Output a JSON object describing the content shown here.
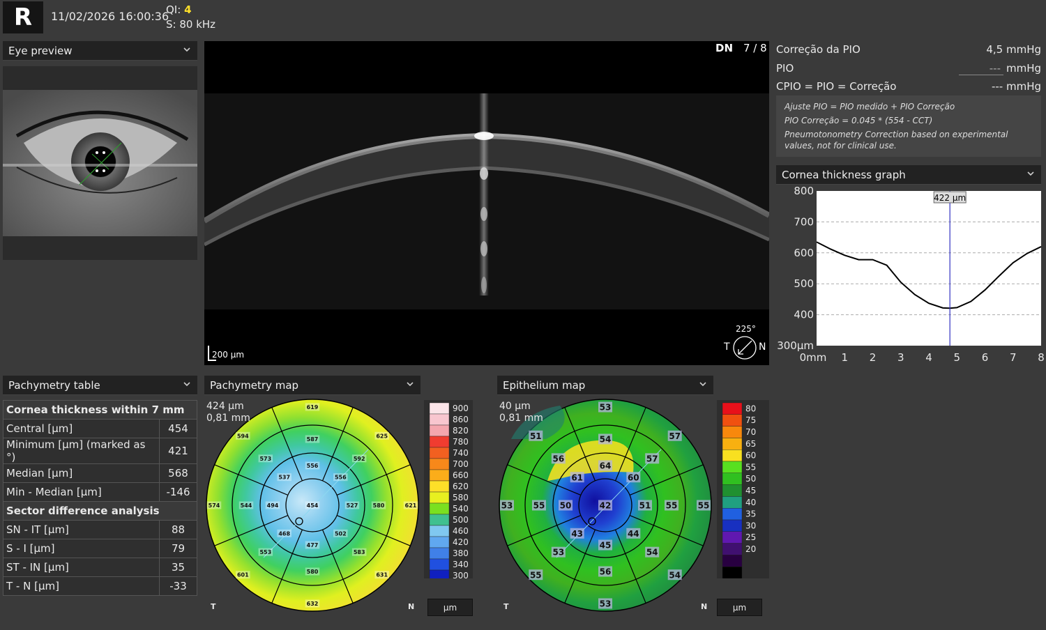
{
  "header": {
    "eye": "R",
    "datetime": "11/02/2026 16:00:36",
    "qi_label": "QI:",
    "qi_value": "4",
    "scan_freq": "S: 80 kHz"
  },
  "eye_preview": {
    "title": "Eye preview"
  },
  "bscan": {
    "view": "DN",
    "index": "7 / 8",
    "scale": "200 µm",
    "angle": "225°",
    "temporal": "T",
    "nasal": "N"
  },
  "pio": {
    "correction_label": "Correção da PIO",
    "correction_value": "4,5 mmHg",
    "pio_label": "PIO",
    "pio_value": "---",
    "pio_unit": "mmHg",
    "cpio_label": "CPIO = PIO = Correção",
    "cpio_value": "--- mmHg",
    "note1": "Ajuste PIO = PIO medido + PIO Correção",
    "note2": "PIO Correção = 0.045 * (554 - CCT)",
    "note3": "Pneumotonometry Correction based on experimental values, not for clinical use."
  },
  "thickness_graph": {
    "title": "Cornea thickness graph",
    "marker_label": "422 µm"
  },
  "chart_data": {
    "type": "line",
    "x": [
      0,
      0.5,
      1,
      1.5,
      2,
      2.5,
      3,
      3.5,
      4,
      4.5,
      4.75,
      5,
      5.5,
      6,
      6.5,
      7,
      7.5,
      8
    ],
    "values": [
      635,
      612,
      592,
      578,
      578,
      560,
      505,
      465,
      437,
      422,
      421,
      423,
      443,
      480,
      525,
      568,
      598,
      620
    ],
    "xlim": [
      0,
      8
    ],
    "ylim": [
      300,
      800
    ],
    "xticks": [
      "0mm",
      "1",
      "2",
      "3",
      "4",
      "5",
      "6",
      "7",
      "8"
    ],
    "yticks": [
      "800",
      "700",
      "600",
      "500",
      "400",
      "300µm"
    ],
    "marker_x": 4.75,
    "grid": true
  },
  "pachy_table": {
    "title": "Pachymetry table",
    "section1": "Cornea thickness within 7 mm",
    "rows1": [
      [
        "Central [µm]",
        "454"
      ],
      [
        "Minimum [µm] (marked as °)",
        "421"
      ],
      [
        "Median [µm]",
        "568"
      ],
      [
        "Min - Median [µm]",
        "-146"
      ]
    ],
    "section2": "Sector difference analysis",
    "rows2": [
      [
        "SN - IT [µm]",
        "88"
      ],
      [
        "S - I [µm]",
        "79"
      ],
      [
        "ST - IN [µm]",
        "35"
      ],
      [
        "T - N [µm]",
        "-33"
      ]
    ]
  },
  "pachy_map": {
    "title": "Pachymetry map",
    "info1": "424 µm",
    "info2": "0,81 mm",
    "T": "T",
    "N": "N",
    "unit": "µm",
    "scale": [
      "900",
      "860",
      "820",
      "780",
      "740",
      "700",
      "660",
      "620",
      "580",
      "540",
      "500",
      "460",
      "420",
      "380",
      "340",
      "300"
    ],
    "center": "454",
    "ring1": [
      "556",
      "537",
      "494",
      "468",
      "477",
      "502",
      "527",
      "556"
    ],
    "ring2": [
      "587",
      "573",
      "544",
      "553",
      "580",
      "583",
      "580",
      "592"
    ],
    "ring3": [
      "619",
      "594",
      "574",
      "601",
      "632",
      "631",
      "621",
      "625"
    ],
    "scale_colors": [
      "#fbe4e8",
      "#f8c6cf",
      "#f4a6ae",
      "#f03c30",
      "#f26020",
      "#f7881a",
      "#fbad1a",
      "#fde028",
      "#e8f020",
      "#7ae020",
      "#40c090",
      "#80c8f0",
      "#60a8f0",
      "#4080e8",
      "#2050e0",
      "#1020c0"
    ]
  },
  "epi_map": {
    "title": "Epithelium map",
    "info1": "40 µm",
    "info2": "0,81 mm",
    "T": "T",
    "N": "N",
    "unit": "µm",
    "scale": [
      "80",
      "75",
      "70",
      "65",
      "60",
      "55",
      "50",
      "45",
      "40",
      "35",
      "30",
      "25",
      "20"
    ],
    "center": "42",
    "ring1": [
      "64",
      "61",
      "50",
      "43",
      "45",
      "44",
      "51",
      "60"
    ],
    "ring2": [
      "54",
      "56",
      "55",
      "53",
      "56",
      "54",
      "55",
      "57"
    ],
    "ring3": [
      "53",
      "51",
      "53",
      "55",
      "53",
      "54",
      "55",
      "57"
    ],
    "scale_colors": [
      "#e8101a",
      "#f05010",
      "#f8880c",
      "#f8b010",
      "#f8e020",
      "#58e020",
      "#30c020",
      "#209030",
      "#20a080",
      "#2060e0",
      "#1830c0",
      "#6018b0",
      "#401070",
      "#280040",
      "#000000"
    ]
  }
}
